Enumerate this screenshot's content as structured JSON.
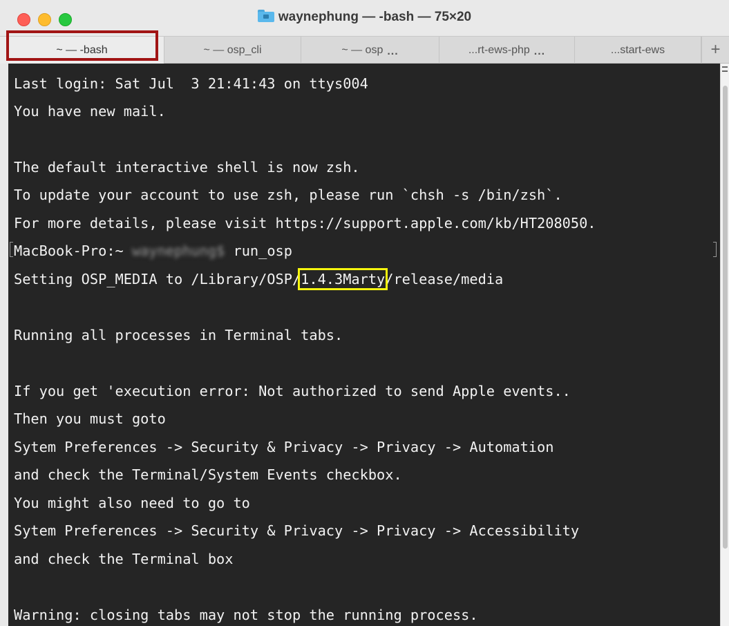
{
  "window": {
    "title": "waynephung — -bash — 75×20"
  },
  "tabs": [
    {
      "label": "~ — -bash"
    },
    {
      "label": "~ — osp_cli"
    },
    {
      "label": "~ — osp"
    },
    {
      "label": "...rt-ews-php"
    },
    {
      "label": "...start-ews"
    }
  ],
  "tab_overflow": "...",
  "new_tab_label": "+",
  "terminal": {
    "lines": [
      "Last login: Sat Jul  3 21:41:43 on ttys004",
      "You have new mail.",
      "",
      "The default interactive shell is now zsh.",
      "To update your account to use zsh, please run `chsh -s /bin/zsh`.",
      "For more details, please visit https://support.apple.com/kb/HT208050.",
      "",
      "",
      "",
      "Running all processes in Terminal tabs.",
      "",
      "If you get 'execution error: Not authorized to send Apple events..",
      "Then you must goto",
      "Sytem Preferences -> Security & Privacy -> Privacy -> Automation",
      "and check the Terminal/System Events checkbox.",
      "You might also need to go to",
      "Sytem Preferences -> Security & Privacy -> Privacy -> Accessibility",
      "and check the Terminal box",
      "",
      "Warning: closing tabs may not stop the running process."
    ],
    "prompt": {
      "host": "MacBook-Pro:~ ",
      "user": "waynephung$",
      "command": " run_osp"
    },
    "media_line": {
      "prefix": "Setting OSP_MEDIA to /Library/OSP/",
      "version": "1.4.3Marty",
      "suffix": "/release/media"
    }
  }
}
